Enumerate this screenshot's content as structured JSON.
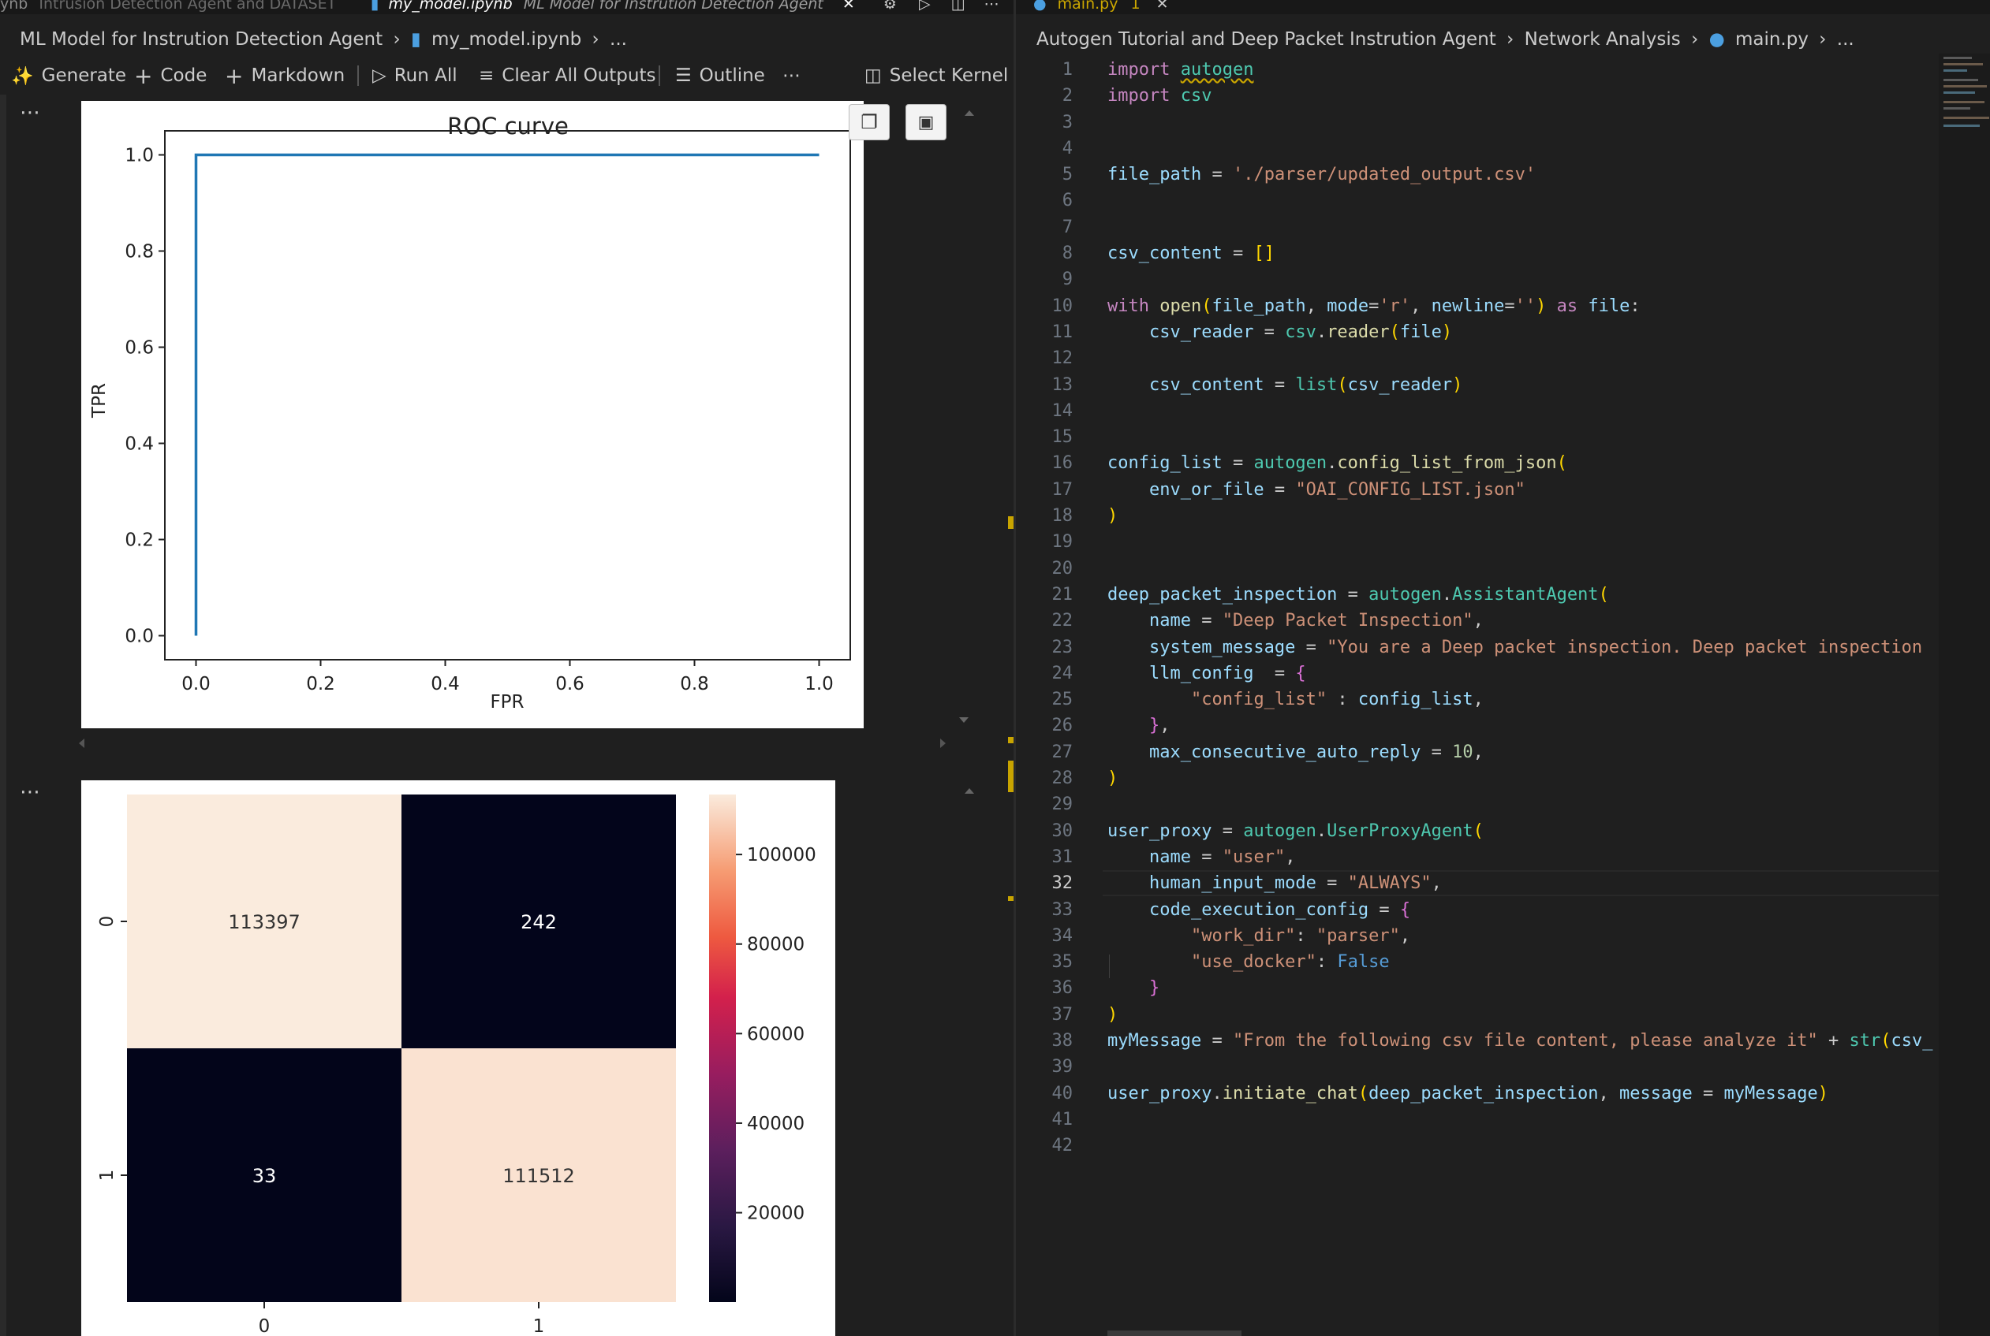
{
  "left": {
    "tabs": [
      {
        "file": "ynb",
        "desc": "Intrusion Detection Agent and DATASET"
      },
      {
        "file": "my_model.ipynb",
        "desc": "ML Model for Instrution Detection Agent"
      }
    ],
    "breadcrumb": [
      "ML Model for Instrution Detection Agent",
      "my_model.ipynb",
      "..."
    ],
    "toolbar": {
      "generate": "Generate",
      "code": "Code",
      "markdown": "Markdown",
      "run_all": "Run All",
      "clear_outputs": "Clear All Outputs",
      "outline": "Outline",
      "more": "⋯",
      "select_kernel": "Select Kernel"
    },
    "cell_menu": "⋯"
  },
  "right": {
    "tab": {
      "file": "main.py",
      "badge": "1"
    },
    "breadcrumb": [
      "Autogen Tutorial and Deep Packet Instrution Agent",
      "Network Analysis",
      "main.py",
      "..."
    ]
  },
  "chart_data": [
    {
      "type": "line",
      "title": "ROC curve",
      "xlabel": "FPR",
      "ylabel": "TPR",
      "xlim": [
        -0.05,
        1.05
      ],
      "ylim": [
        -0.05,
        1.05
      ],
      "xticks": [
        "0.0",
        "0.2",
        "0.4",
        "0.6",
        "0.8",
        "1.0"
      ],
      "yticks": [
        "0.0",
        "0.2",
        "0.4",
        "0.6",
        "0.8",
        "1.0"
      ],
      "series": [
        {
          "x": [
            0.0,
            0.0,
            1.0
          ],
          "y": [
            0.0,
            1.0,
            1.0
          ]
        }
      ],
      "line_color": "#1f77b4",
      "grid": false
    },
    {
      "type": "heatmap",
      "rows": [
        "0",
        "1"
      ],
      "cols": [
        "0",
        "1"
      ],
      "values": [
        [
          113397,
          242
        ],
        [
          33,
          111512
        ]
      ],
      "colorbar_ticks": [
        "100000",
        "80000",
        "60000",
        "40000",
        "20000"
      ],
      "colorbar_range": [
        33,
        113397
      ],
      "colormap": "rocket",
      "annotated": true
    }
  ]
}
